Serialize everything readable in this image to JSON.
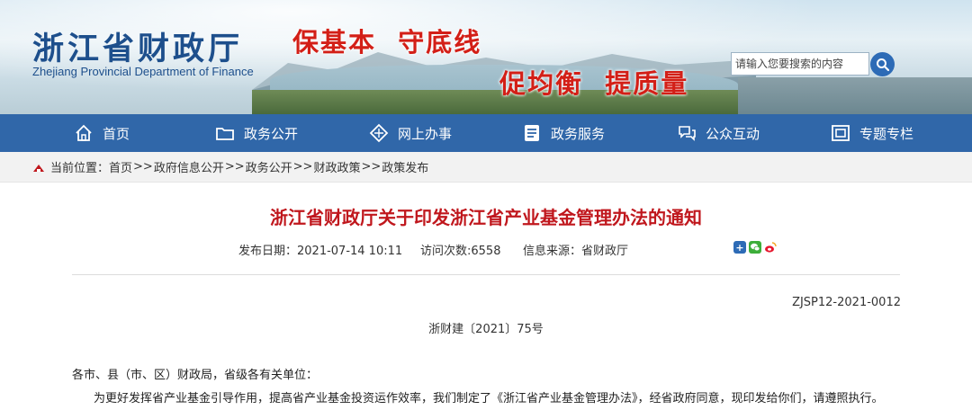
{
  "site": {
    "title_cn": "浙江省财政厅",
    "title_en": "Zhejiang Provincial Department of Finance",
    "slogan1": "保基本  守底线",
    "slogan2": "促均衡  提质量"
  },
  "search": {
    "placeholder": "请输入您要搜索的内容",
    "button_icon": "search-icon"
  },
  "nav": {
    "items": [
      {
        "label": "首页",
        "icon": "home-icon"
      },
      {
        "label": "政务公开",
        "icon": "folder-icon"
      },
      {
        "label": "网上办事",
        "icon": "diamond-icon"
      },
      {
        "label": "政务服务",
        "icon": "document-icon"
      },
      {
        "label": "公众互动",
        "icon": "chat-icon"
      },
      {
        "label": "专题专栏",
        "icon": "window-icon"
      }
    ]
  },
  "breadcrumb": {
    "prefix": "当前位置：",
    "items": [
      "首页",
      "政府信息公开",
      "政务公开",
      "财政政策",
      "政策发布"
    ],
    "separator": ">>"
  },
  "article": {
    "title": "浙江省财政厅关于印发浙江省产业基金管理办法的通知",
    "publish_date": "发布日期：2021-07-14 10:11",
    "visits": "访问次数:6558",
    "source": "信息来源：省财政厅",
    "doc_code": "ZJSP12-2021-0012",
    "file_number": "浙财建〔2021〕75号",
    "addressee": "各市、县（市、区）财政局，省级各有关单位：",
    "paragraph1": "为更好发挥省产业基金引导作用，提高省产业基金投资运作效率，我们制定了《浙江省产业基金管理办法》，经省政府同意，现印发给你们，请遵照执行。"
  },
  "colors": {
    "nav_bg": "#3067a9",
    "title_red": "#c0171d",
    "slogan_red": "#d31f17",
    "logo_blue": "#1d4f8c"
  }
}
